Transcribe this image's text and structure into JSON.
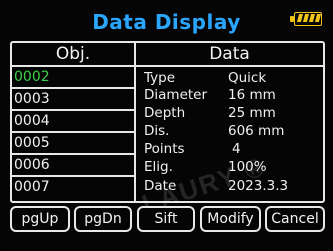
{
  "header": {
    "title": "Data Display"
  },
  "battery": {
    "level_bars": 4
  },
  "table": {
    "obj_header": "Obj.",
    "data_header": "Data",
    "rows": [
      "0002",
      "0003",
      "0004",
      "0005",
      "0006",
      "0007"
    ],
    "selected_index": 0
  },
  "details": [
    {
      "label": "Type",
      "value": "Quick"
    },
    {
      "label": "Diameter",
      "value": "16 mm"
    },
    {
      "label": "Depth",
      "value": "25 mm"
    },
    {
      "label": "Dis.",
      "value": "606 mm"
    },
    {
      "label": "Points",
      "value": "4"
    },
    {
      "label": "Elig.",
      "value": "100%"
    },
    {
      "label": "Date",
      "value": "2023.3.3"
    }
  ],
  "buttons": {
    "pgup": "pgUp",
    "pgdn": "pgDn",
    "sift": "Sift",
    "modify": "Modify",
    "cancel": "Cancel"
  },
  "watermark": "LAURY ®",
  "colors": {
    "title": "#2aa6ff",
    "selected": "#3fd04a",
    "battery": "#f0c419",
    "border": "#e8e8e8"
  }
}
